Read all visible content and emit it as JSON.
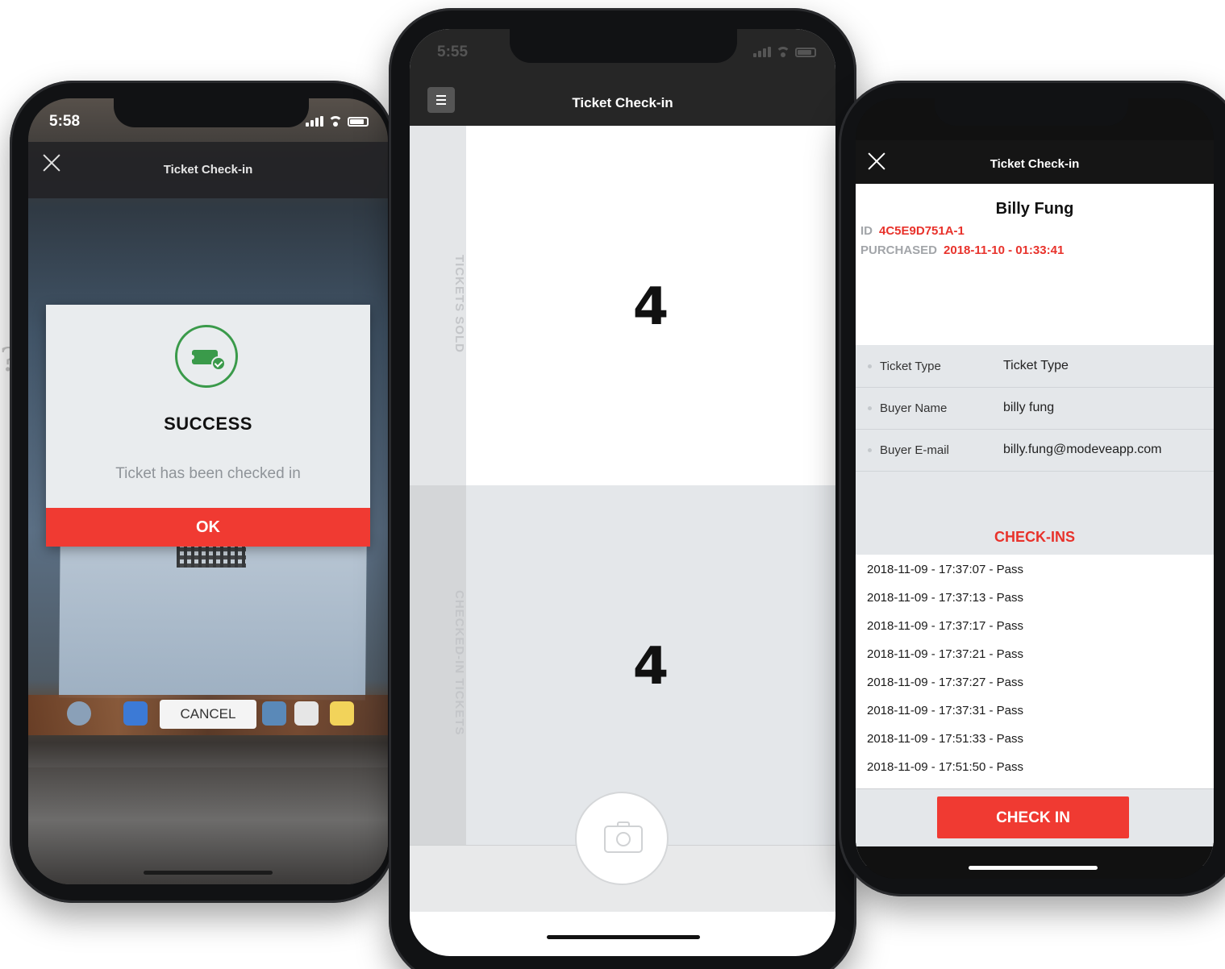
{
  "left_phone": {
    "status_time": "5:58",
    "header_title": "Ticket Check-in",
    "modal": {
      "icon": "ticket-check-icon",
      "heading": "SUCCESS",
      "message": "Ticket has been checked in",
      "ok_label": "OK"
    },
    "cancel_label": "CANCEL"
  },
  "center_phone": {
    "status_time": "5:55",
    "header_title": "Ticket Check-in",
    "sections": [
      {
        "label": "TICKETS SOLD",
        "value": "4"
      },
      {
        "label": "CHECKED-IN TICKETS",
        "value": "4"
      }
    ],
    "scan_icon": "camera-icon"
  },
  "right_phone": {
    "header_title": "Ticket Check-in",
    "buyer_name": "Billy Fung",
    "id_label": "ID",
    "id_value": "4C5E9D751A-1",
    "purchased_label": "PURCHASED",
    "purchased_value": "2018-11-10 - 01:33:41",
    "details": [
      {
        "label": "Ticket Type",
        "value": "Ticket Type"
      },
      {
        "label": "Buyer Name",
        "value": "billy fung"
      },
      {
        "label": "Buyer E-mail",
        "value": "billy.fung@modeveapp.com"
      }
    ],
    "checkins_heading": "CHECK-INS",
    "checkins": [
      "2018-11-09 - 17:37:07 - Pass",
      "2018-11-09 - 17:37:13 - Pass",
      "2018-11-09 - 17:37:17 - Pass",
      "2018-11-09 - 17:37:21 - Pass",
      "2018-11-09 - 17:37:27 - Pass",
      "2018-11-09 - 17:37:31 - Pass",
      "2018-11-09 - 17:51:33 - Pass",
      "2018-11-09 - 17:51:50 - Pass"
    ],
    "checkin_button": "CHECK IN"
  },
  "colors": {
    "accent_red": "#f03a32",
    "success_green": "#3a9a4a",
    "header_dark": "#262626"
  }
}
